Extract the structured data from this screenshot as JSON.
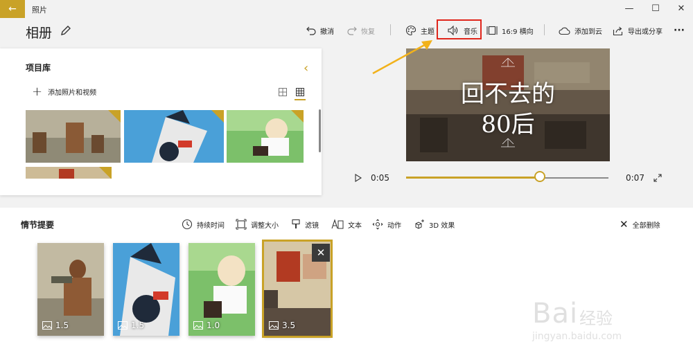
{
  "app": {
    "title": "照片"
  },
  "window": {
    "minimize": "—",
    "maximize": "☐",
    "close": "✕"
  },
  "album": {
    "title": "相册"
  },
  "toolbar": {
    "undo": "撤消",
    "redo": "恢复",
    "theme": "主题",
    "music": "音乐",
    "aspect": "16:9 横向",
    "cloud": "添加到云",
    "export": "导出或分享",
    "more": "···"
  },
  "library": {
    "title": "项目库",
    "add_label": "添加照片和视频",
    "items": [
      {
        "name": "photo-boys-river"
      },
      {
        "name": "photo-cartoon-bike"
      },
      {
        "name": "photo-cartoon-boy"
      },
      {
        "name": "photo-wall-text"
      }
    ]
  },
  "preview": {
    "line1": "回不去的",
    "line2": "80后",
    "current_time": "0:05",
    "total_time": "0:07",
    "progress": 0.66
  },
  "storyboard": {
    "title": "情节提要",
    "tools": {
      "duration": "持续时间",
      "resize": "调整大小",
      "filter": "滤镜",
      "text": "文本",
      "motion": "动作",
      "effects3d": "3D 效果",
      "delete_all": "全部删除"
    },
    "cards": [
      {
        "duration": "1.5"
      },
      {
        "duration": "1.5"
      },
      {
        "duration": "1.0"
      },
      {
        "duration": "3.5"
      }
    ]
  },
  "watermark": {
    "brand": "Bai",
    "brand_cn": "经验",
    "url": "jingyan.baidu.com"
  },
  "colors": {
    "accent": "#c9a227",
    "highlight": "#e0251b",
    "arrow": "#f2b21b"
  }
}
